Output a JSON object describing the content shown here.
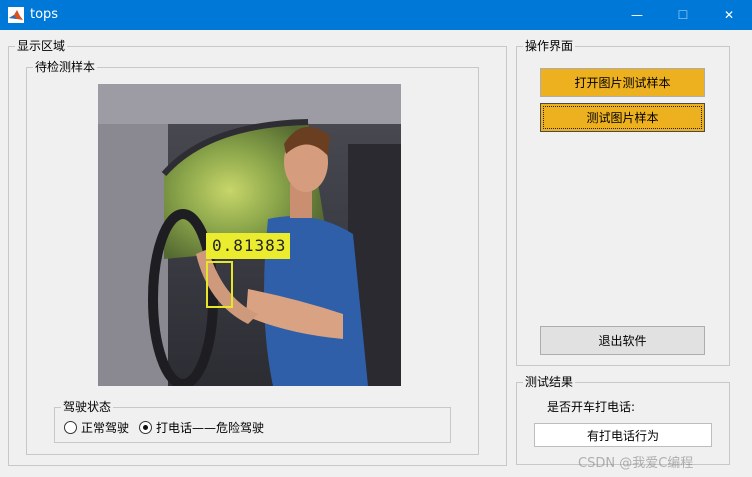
{
  "window": {
    "title": "tops",
    "controls": {
      "minimize": "—",
      "maximize": "☐",
      "close": "✕"
    },
    "icon": "matlab-logo-icon"
  },
  "display_panel": {
    "label": "显示区域",
    "sample_panel": {
      "label": "待检测样本",
      "detection": {
        "score": "0.81383",
        "box_color": "#e8e628"
      }
    },
    "driving_state": {
      "label": "驾驶状态",
      "options": [
        {
          "label": "正常驾驶",
          "checked": false
        },
        {
          "label": "打电话——危险驾驶",
          "checked": true
        }
      ]
    }
  },
  "operation_panel": {
    "label": "操作界面",
    "buttons": {
      "open_sample": "打开图片测试样本",
      "test_sample": "测试图片样本",
      "exit": "退出软件"
    },
    "accent_color": "#edb120"
  },
  "result_panel": {
    "label": "测试结果",
    "question": "是否开车打电话:",
    "value": "有打电话行为"
  },
  "watermark": "CSDN @我爱C编程"
}
